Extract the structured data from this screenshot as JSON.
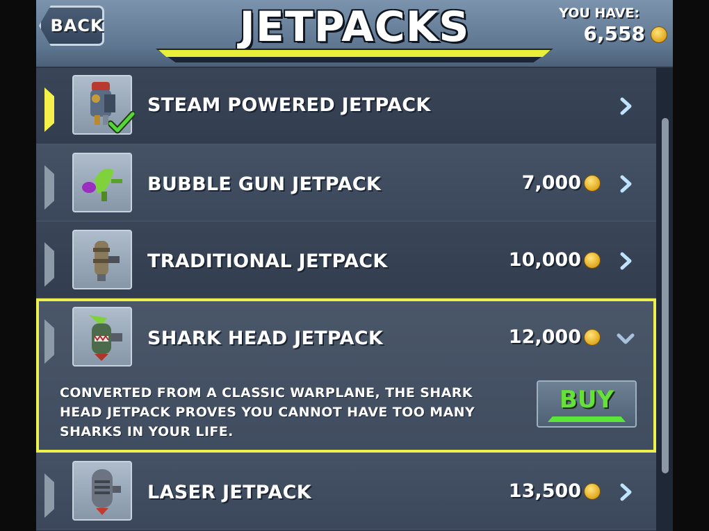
{
  "header": {
    "back_label": "BACK",
    "title": "JETPACKS",
    "balance_label": "YOU HAVE:",
    "balance_value": "6,558"
  },
  "items": [
    {
      "name": "STEAM POWERED JETPACK",
      "price": "",
      "owned": true,
      "selected": false
    },
    {
      "name": "BUBBLE GUN JETPACK",
      "price": "7,000",
      "owned": false,
      "selected": false
    },
    {
      "name": "TRADITIONAL JETPACK",
      "price": "10,000",
      "owned": false,
      "selected": false
    },
    {
      "name": "SHARK HEAD JETPACK",
      "price": "12,000",
      "owned": false,
      "selected": true,
      "description": "CONVERTED FROM A CLASSIC WARPLANE, THE SHARK HEAD JETPACK PROVES YOU CANNOT HAVE TOO MANY SHARKS IN YOUR LIFE.",
      "buy_label": "BUY"
    },
    {
      "name": "LASER JETPACK",
      "price": "13,500",
      "owned": false,
      "selected": false
    }
  ],
  "colors": {
    "highlight": "#eef14c",
    "buy_text": "#66e13a",
    "coin": "#e1a81e"
  },
  "icons": [
    "coin-icon",
    "chevron-right-icon",
    "chevron-down-icon",
    "checkmark-icon"
  ]
}
